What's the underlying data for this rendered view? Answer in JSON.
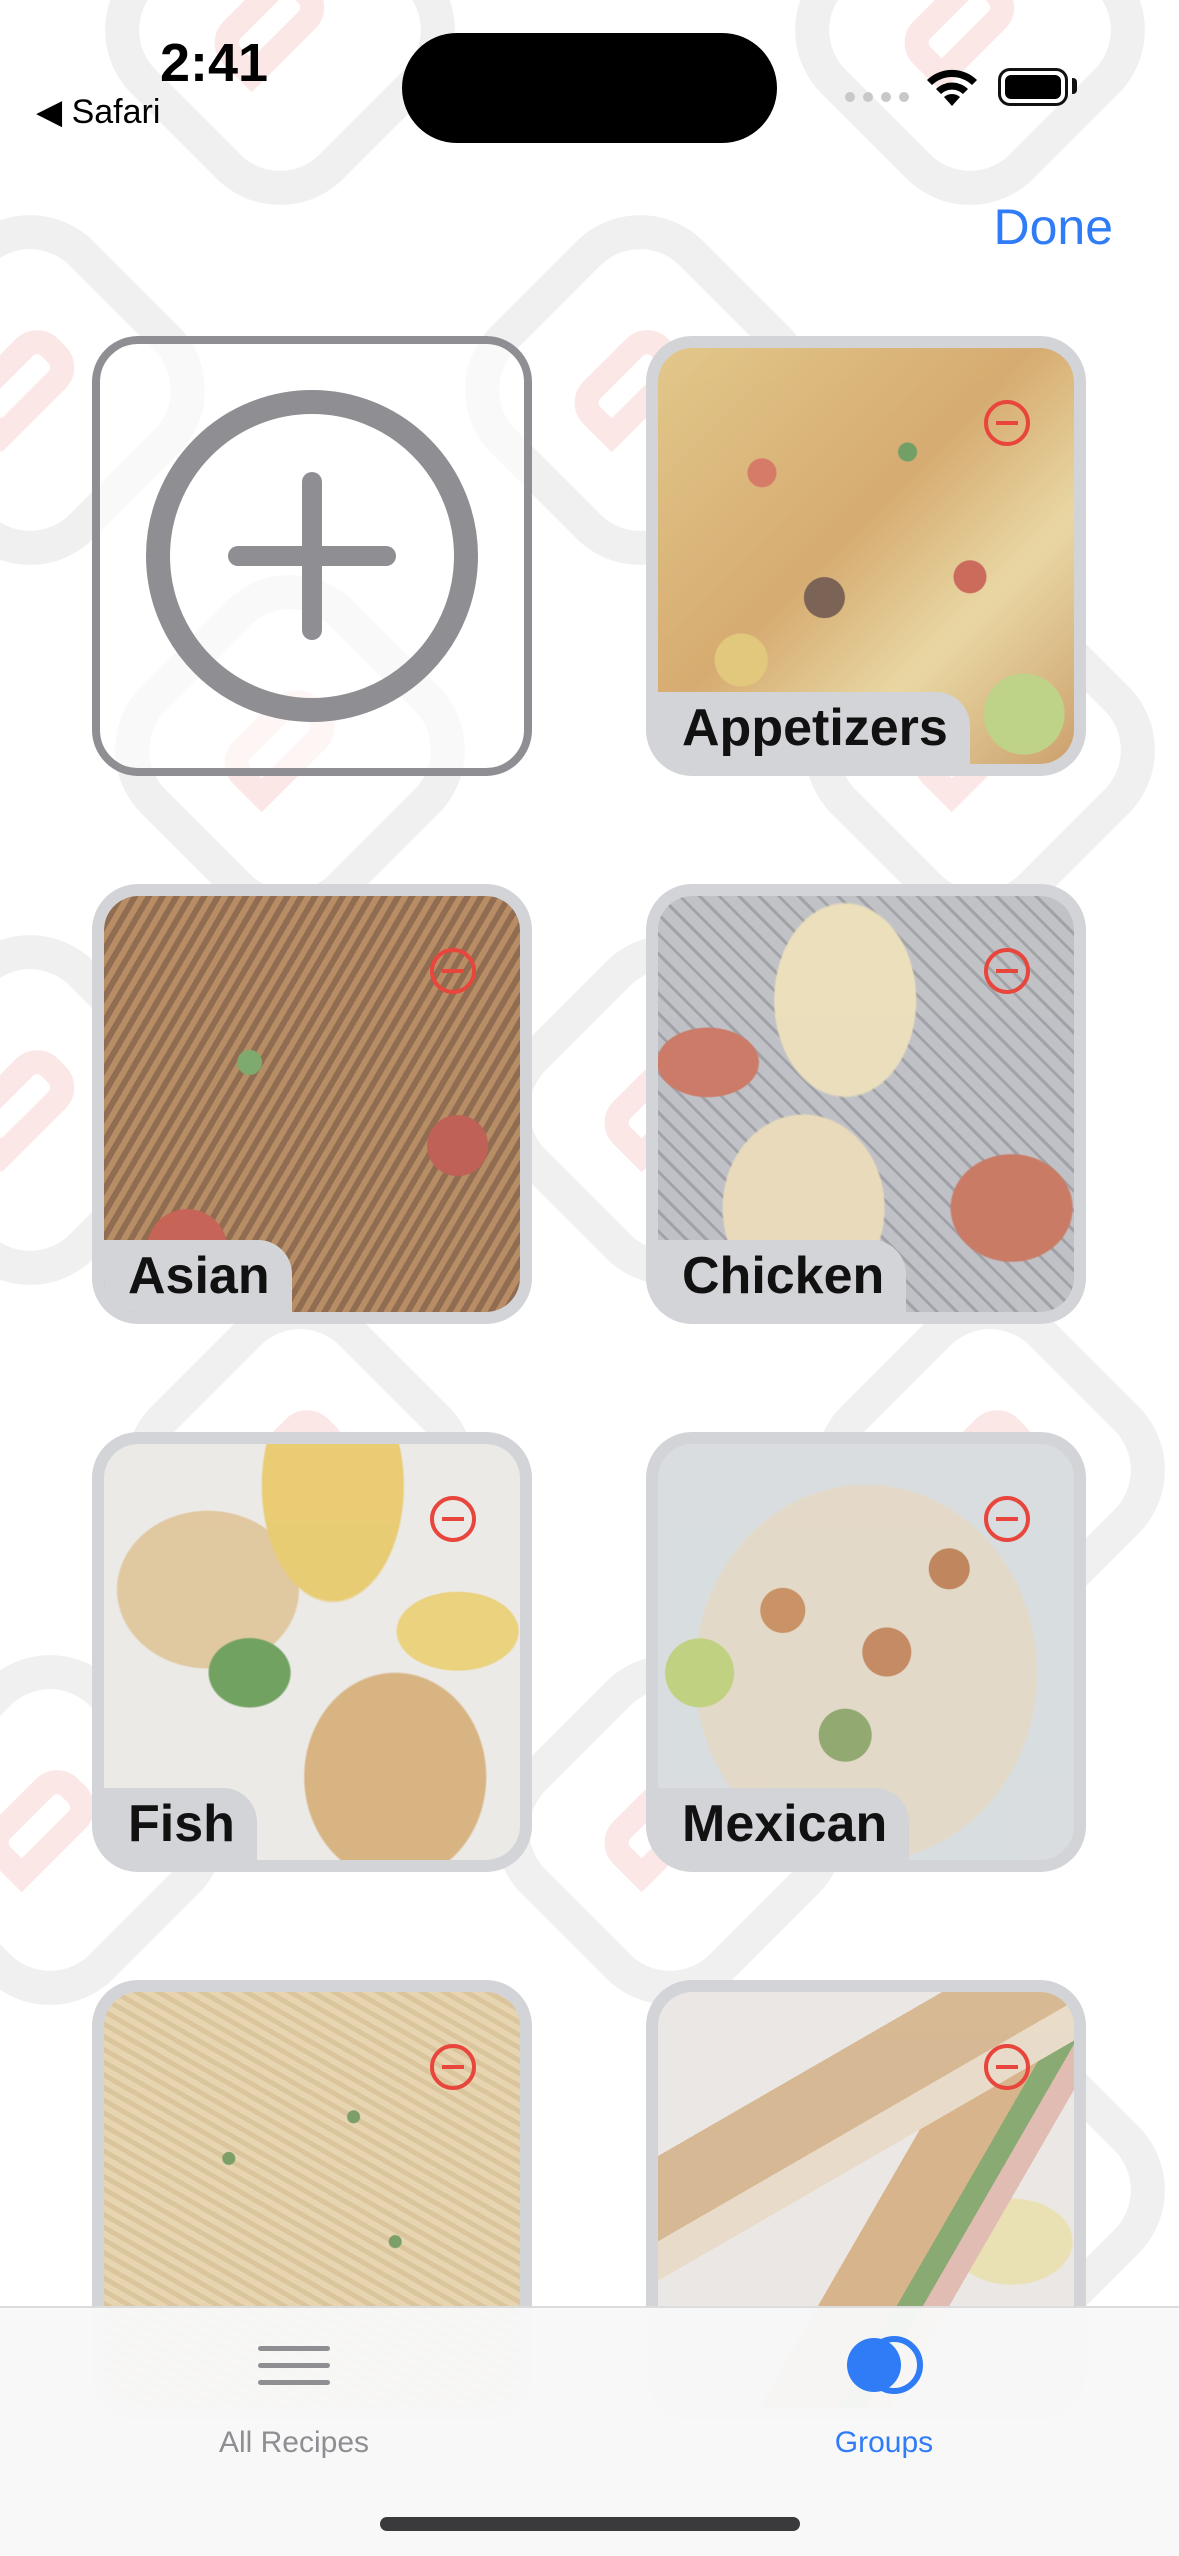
{
  "status_bar": {
    "time": "2:41",
    "back_app": "◀ Safari"
  },
  "header": {
    "done_label": "Done"
  },
  "groups": [
    {
      "label": "Appetizers",
      "photo": "nachos"
    },
    {
      "label": "Asian",
      "photo": "noodles"
    },
    {
      "label": "Chicken",
      "photo": "chicken-parmesan"
    },
    {
      "label": "Fish",
      "photo": "breaded-fish-lemon"
    },
    {
      "label": "Mexican",
      "photo": "shrimp-tacos"
    },
    {
      "label": "",
      "photo": "creamy-pasta"
    },
    {
      "label": "",
      "photo": "club-sandwich"
    }
  ],
  "tab_bar": {
    "items": [
      {
        "label": "All Recipes",
        "icon": "list-icon",
        "selected": false
      },
      {
        "label": "Groups",
        "icon": "groups-icon",
        "selected": true
      }
    ]
  },
  "colors": {
    "accent": "#2f7cf6",
    "remove": "#e8453c",
    "tile_border": "#d3d4d8",
    "inactive": "#8e8e93"
  }
}
